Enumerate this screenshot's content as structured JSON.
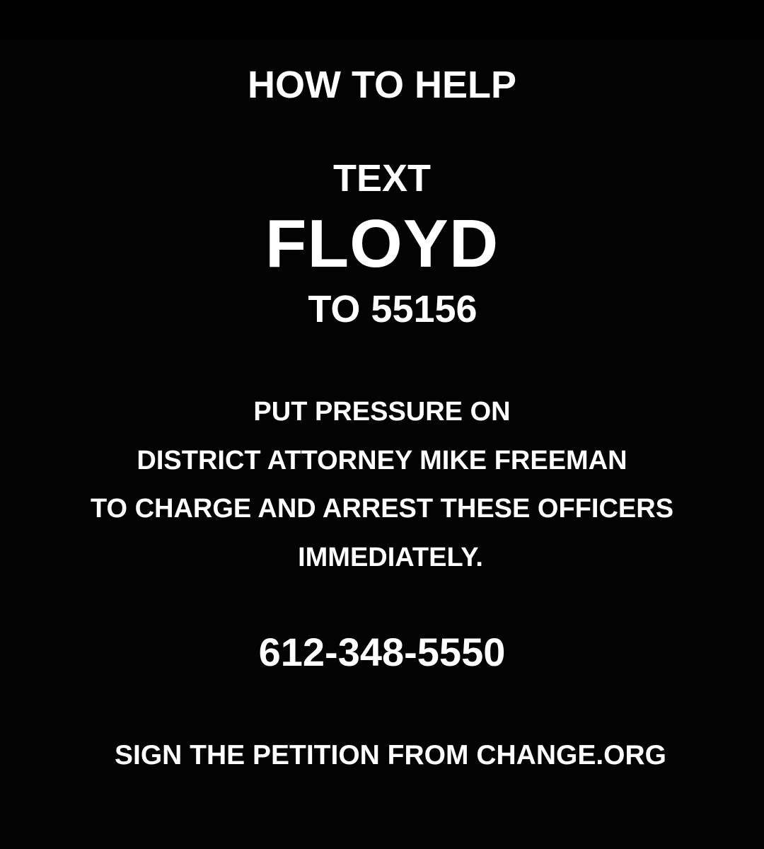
{
  "poster": {
    "heading": "HOW TO HELP",
    "text_word": "TEXT",
    "keyword": "FLOYD",
    "shortcode_line": "TO 55156",
    "pressure_lines": [
      "PUT PRESSURE ON",
      "DISTRICT ATTORNEY MIKE FREEMAN",
      "TO CHARGE AND ARREST THESE OFFICERS",
      "IMMEDIATELY."
    ],
    "phone": "612-348-5550",
    "petition": "SIGN THE PETITION FROM CHANGE.ORG"
  },
  "colors": {
    "background": "#000000",
    "text": "#ffffff"
  }
}
